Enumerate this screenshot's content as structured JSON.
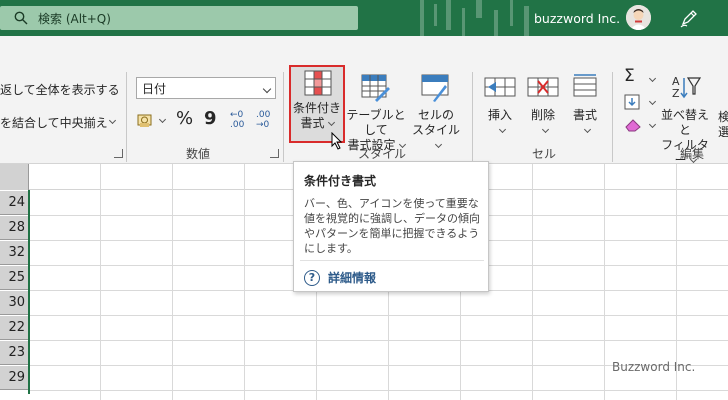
{
  "titlebar": {
    "search_text": "検索 (Alt+Q)",
    "account_name": "buzzword Inc."
  },
  "ribbon": {
    "alignment": {
      "wrap_text": "返して全体を表示する",
      "merge_center": "を結合して中央揃え"
    },
    "number": {
      "format_value": "日付",
      "percent": "%",
      "comma": "9",
      "inc_decimal": "←0 .00",
      "dec_decimal": ".00 →0",
      "group_label": "数値"
    },
    "styles": {
      "conditional_formatting_line1": "条件付き",
      "conditional_formatting_line2": "書式",
      "format_as_table_line1": "テーブルとして",
      "format_as_table_line2": "書式設定",
      "cell_styles_line1": "セルの",
      "cell_styles_line2": "スタイル",
      "group_label": "スタイル"
    },
    "cells": {
      "insert": "挿入",
      "delete": "削除",
      "format": "書式",
      "group_label": "セル"
    },
    "editing": {
      "sort_filter_line1": "並べ替えと",
      "sort_filter_line2": "フィルター",
      "group_label": "編集",
      "partial_line1": "検",
      "partial_line2": "選"
    }
  },
  "sheet": {
    "row_values": [
      "24",
      "28",
      "32",
      "25",
      "30",
      "22",
      "23",
      "29"
    ]
  },
  "tooltip": {
    "title": "条件付き書式",
    "body": "バー、色、アイコンを使って重要な値を視覚的に強調し、データの傾向やパターンを簡単に把握できるようにします。",
    "link": "詳細情報"
  },
  "watermark": "Buzzword Inc.",
  "colors": {
    "titlebar": "#217346",
    "highlight": "#d92b2b",
    "link": "#2e5b8a"
  }
}
